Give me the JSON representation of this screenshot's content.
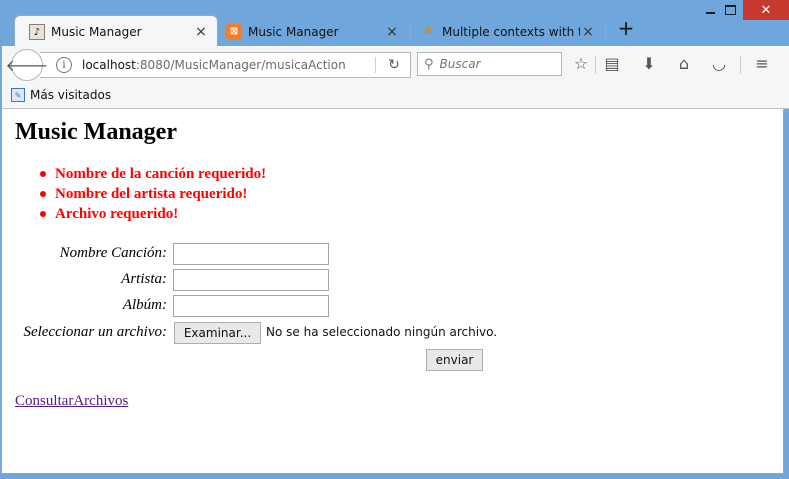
{
  "tabs": [
    {
      "title": "Music Manager",
      "favicon": "music-app-icon",
      "active": true
    },
    {
      "title": "Music Manager",
      "favicon": "xampp-icon",
      "active": false
    },
    {
      "title": "Multiple contexts with t...",
      "favicon": "stackoverflow-icon",
      "active": false
    }
  ],
  "tab_close_glyph": "×",
  "new_tab_glyph": "+",
  "address": {
    "host": "localhost",
    "rest": ":8080/MusicManager/musicaAction"
  },
  "search": {
    "placeholder": "Buscar"
  },
  "bookmarks": [
    {
      "label": "Más visitados"
    }
  ],
  "page": {
    "title": "Music Manager",
    "errors": [
      "Nombre de la canción requerido!",
      "Nombre del artista requerido!",
      "Archivo requerido!"
    ],
    "form": {
      "song_label": "Nombre Canción:",
      "song_value": "",
      "artist_label": "Artista:",
      "artist_value": "",
      "album_label": "Albúm:",
      "album_value": "",
      "file_label": "Seleccionar un archivo:",
      "file_button": "Examinar...",
      "file_status": "No se ha seleccionado ningún archivo.",
      "submit_label": "enviar"
    },
    "link_label": "ConsultarArchivos"
  },
  "colors": {
    "error": "#ff0000",
    "link_visited": "#551a8b",
    "titlebar": "#6fa6dc",
    "close_button": "#c7392f"
  }
}
